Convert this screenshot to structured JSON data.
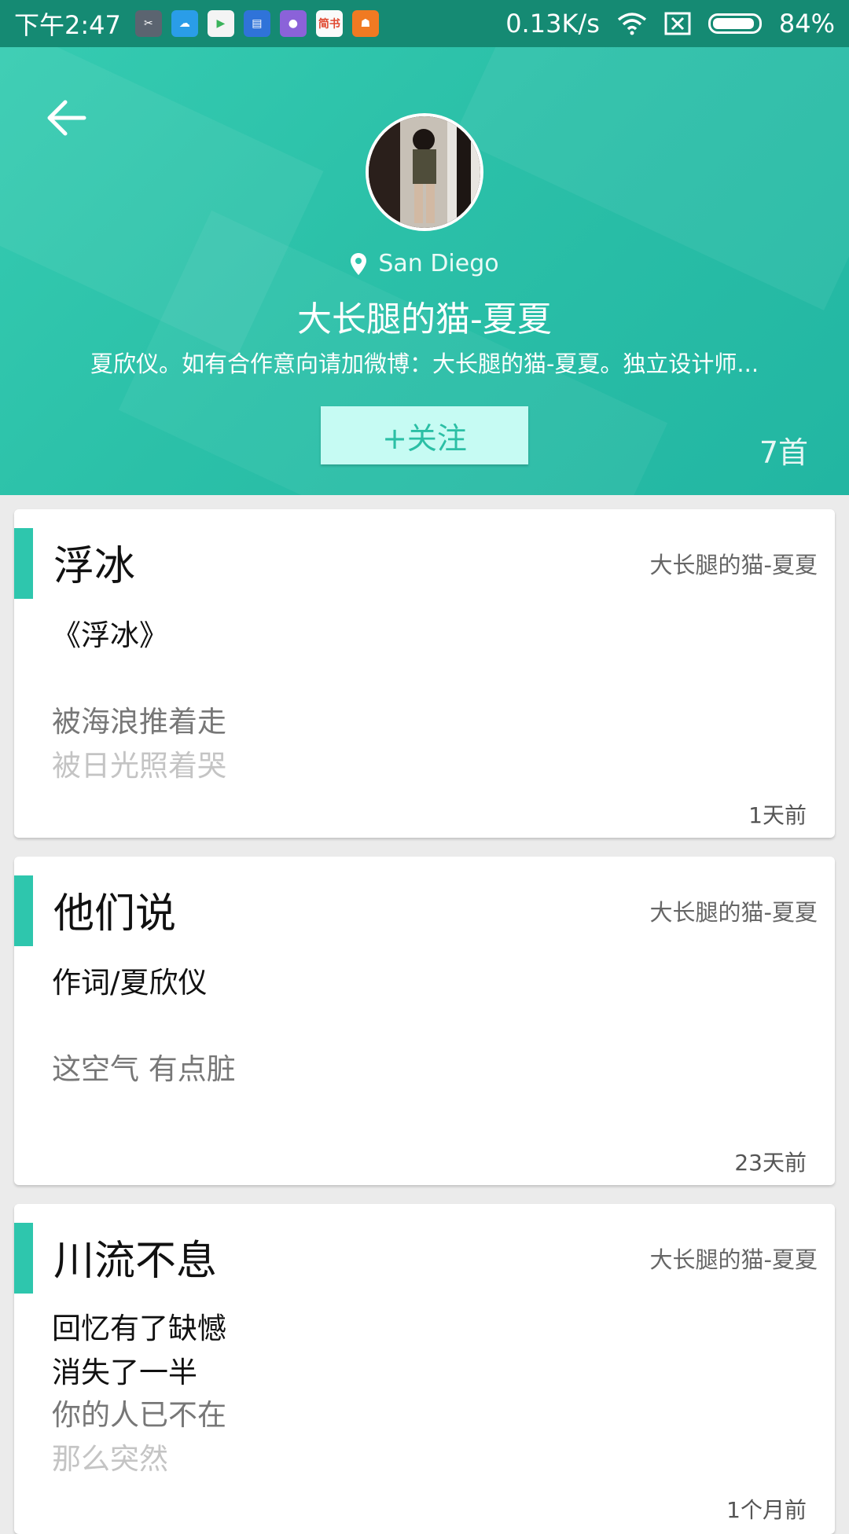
{
  "status": {
    "time": "下午2:47",
    "network_speed": "0.13K/s",
    "battery": "84%",
    "app_icons": [
      "scissor-app-icon",
      "cloud-app-icon",
      "play-store-icon",
      "news-app-icon",
      "circle-app-icon",
      "jianshu-app-icon",
      "store-app-icon"
    ],
    "jianshu_label": "简书"
  },
  "profile": {
    "location": "San Diego",
    "name": "大长腿的猫-夏夏",
    "bio": "夏欣仪。如有合作意向请加微博：大长腿的猫-夏夏。独立设计师...",
    "follow_label": "+关注",
    "song_count": "7首"
  },
  "songs": [
    {
      "title": "浮冰",
      "author": "大长腿的猫-夏夏",
      "lines": [
        "《浮冰》",
        "",
        "被海浪推着走",
        "被日光照着哭"
      ],
      "time": "1天前"
    },
    {
      "title": "他们说",
      "author": "大长腿的猫-夏夏",
      "lines": [
        "作词/夏欣仪",
        "",
        "这空气 有点脏"
      ],
      "time": "23天前"
    },
    {
      "title": "川流不息",
      "author": "大长腿的猫-夏夏",
      "lines": [
        "回忆有了缺憾",
        "消失了一半",
        "你的人已不在",
        "那么突然"
      ],
      "time": "1个月前"
    }
  ],
  "colors": {
    "accent": "#2ec6ad",
    "statusbar": "#158a73"
  }
}
